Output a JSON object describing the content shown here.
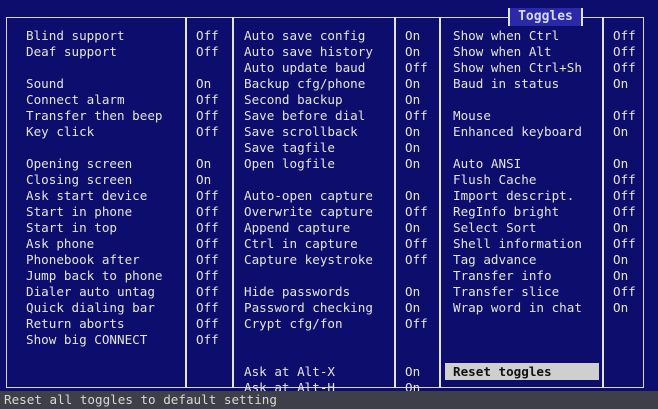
{
  "window": {
    "title": "Toggles"
  },
  "columns": [
    {
      "items": [
        {
          "label": "Blind support",
          "value": "Off"
        },
        {
          "label": "Deaf support",
          "value": "Off"
        },
        null,
        {
          "label": "Sound",
          "value": "On"
        },
        {
          "label": "Connect alarm",
          "value": "Off"
        },
        {
          "label": "Transfer then beep",
          "value": "Off"
        },
        {
          "label": "Key click",
          "value": "Off"
        },
        null,
        {
          "label": "Opening screen",
          "value": "On"
        },
        {
          "label": "Closing screen",
          "value": "On"
        },
        {
          "label": "Ask start device",
          "value": "Off"
        },
        {
          "label": "Start in phone",
          "value": "Off"
        },
        {
          "label": "Start in top",
          "value": "Off"
        },
        {
          "label": "Ask phone",
          "value": "Off"
        },
        {
          "label": "Phonebook after",
          "value": "Off"
        },
        {
          "label": "Jump back to phone",
          "value": "Off"
        },
        {
          "label": "Dialer auto untag",
          "value": "Off"
        },
        {
          "label": "Quick dialing bar",
          "value": "Off"
        },
        {
          "label": "Return aborts",
          "value": "Off"
        },
        {
          "label": "Show big CONNECT",
          "value": "Off"
        }
      ]
    },
    {
      "items": [
        {
          "label": "Auto save config",
          "value": "On"
        },
        {
          "label": "Auto save history",
          "value": "On"
        },
        {
          "label": "Auto update baud",
          "value": "Off"
        },
        {
          "label": "Backup cfg/phone",
          "value": "On"
        },
        {
          "label": "Second backup",
          "value": "On"
        },
        {
          "label": "Save before dial",
          "value": "Off"
        },
        {
          "label": "Save scrollback",
          "value": "On"
        },
        {
          "label": "Save tagfile",
          "value": "On"
        },
        {
          "label": "Open logfile",
          "value": "On"
        },
        null,
        {
          "label": "Auto-open capture",
          "value": "On"
        },
        {
          "label": "Overwrite capture",
          "value": "Off"
        },
        {
          "label": "Append capture",
          "value": "On"
        },
        {
          "label": "Ctrl in capture",
          "value": "Off"
        },
        {
          "label": "Capture keystroke",
          "value": "Off"
        },
        null,
        {
          "label": "Hide passwords",
          "value": "On"
        },
        {
          "label": "Password checking",
          "value": "On"
        },
        {
          "label": "Crypt cfg/fon",
          "value": "Off"
        },
        null,
        null,
        {
          "label": "Ask at Alt-X",
          "value": "On"
        },
        {
          "label": "Ask at Alt-H",
          "value": "On"
        }
      ]
    },
    {
      "items": [
        {
          "label": "Show when Ctrl",
          "value": "Off"
        },
        {
          "label": "Show when Alt",
          "value": "Off"
        },
        {
          "label": "Show when Ctrl+Sh",
          "value": "Off"
        },
        {
          "label": "Baud in status",
          "value": "On"
        },
        null,
        {
          "label": "Mouse",
          "value": "Off"
        },
        {
          "label": "Enhanced keyboard",
          "value": "On"
        },
        null,
        {
          "label": "Auto ANSI",
          "value": "On"
        },
        {
          "label": "Flush Cache",
          "value": "Off"
        },
        {
          "label": "Import descript.",
          "value": "Off"
        },
        {
          "label": "RegInfo bright",
          "value": "Off"
        },
        {
          "label": "Select Sort",
          "value": "On"
        },
        {
          "label": "Shell information",
          "value": "Off"
        },
        {
          "label": "Tag advance",
          "value": "On"
        },
        {
          "label": "Transfer info",
          "value": "On"
        },
        {
          "label": "Transfer slice",
          "value": "Off"
        },
        {
          "label": "Wrap word in chat",
          "value": "On"
        }
      ]
    }
  ],
  "reset_button": "Reset toggles",
  "status_bar": "Reset all toggles to default setting",
  "colors": {
    "background": "#0d0d6e",
    "text": "#e4e4dc",
    "title_bg": "#2a2aa8",
    "button_bg": "#cfcfcf"
  }
}
